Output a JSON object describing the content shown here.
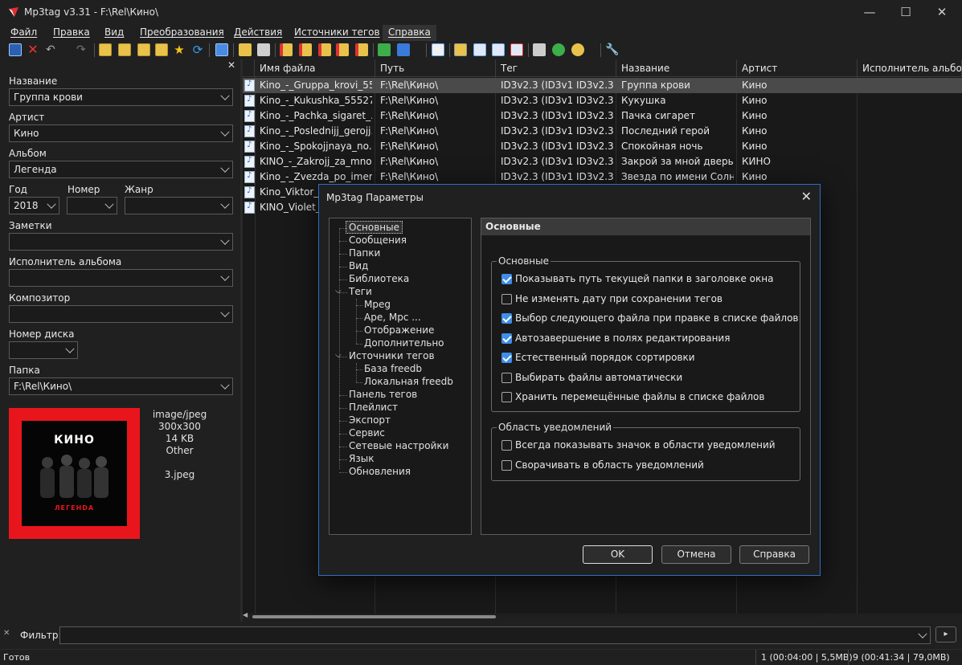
{
  "window": {
    "title": "Mp3tag v3.31  -  F:\\Rel\\Кино\\",
    "minimize": "—",
    "maximize": "☐",
    "close": "✕"
  },
  "menu": [
    "Файл",
    "Правка",
    "Вид",
    "Преобразования",
    "Действия",
    "Источники тегов",
    "Справка"
  ],
  "left_panel": {
    "close": "✕",
    "fields": {
      "title_label": "Название",
      "title_value": "Группа крови",
      "artist_label": "Артист",
      "artist_value": "Кино",
      "album_label": "Альбом",
      "album_value": "Легенда",
      "year_label": "Год",
      "year_value": "2018",
      "track_label": "Номер",
      "track_value": "",
      "genre_label": "Жанр",
      "genre_value": "",
      "comment_label": "Заметки",
      "comment_value": "",
      "albumartist_label": "Исполнитель альбома",
      "albumartist_value": "",
      "composer_label": "Композитор",
      "composer_value": "",
      "discnumber_label": "Номер диска",
      "discnumber_value": "",
      "folder_label": "Папка",
      "folder_value": "F:\\Rel\\Кино\\"
    },
    "cover": {
      "band": "КИНО",
      "album": "ЛЕГЕНDА"
    },
    "image_info": {
      "mime": "image/jpeg",
      "dims": "300x300",
      "size": "14 KB",
      "type": "Other",
      "file": "3.jpeg"
    }
  },
  "file_list": {
    "headers": [
      "Имя файла",
      "Путь",
      "Тег",
      "Название",
      "Артист",
      "Исполнитель альбома"
    ],
    "rows": [
      {
        "file": "Kino_-_Gruppa_krovi_55...",
        "path": "F:\\Rel\\Кино\\",
        "tag": "ID3v2.3 (ID3v1 ID3v2.3)",
        "title": "Группа крови",
        "artist": "Кино"
      },
      {
        "file": "Kino_-_Kukushka_55527...",
        "path": "F:\\Rel\\Кино\\",
        "tag": "ID3v2.3 (ID3v1 ID3v2.3)",
        "title": "Кукушка",
        "artist": "Кино"
      },
      {
        "file": "Kino_-_Pachka_sigaret_...",
        "path": "F:\\Rel\\Кино\\",
        "tag": "ID3v2.3 (ID3v1 ID3v2.3)",
        "title": "Пачка сигарет",
        "artist": "Кино"
      },
      {
        "file": "Kino_-_Poslednijj_gerojj...",
        "path": "F:\\Rel\\Кино\\",
        "tag": "ID3v2.3 (ID3v1 ID3v2.3)",
        "title": "Последний герой",
        "artist": "Кино"
      },
      {
        "file": "Kino_-_Spokojjnaya_no...",
        "path": "F:\\Rel\\Кино\\",
        "tag": "ID3v2.3 (ID3v1 ID3v2.3)",
        "title": "Спокойная ночь",
        "artist": "Кино"
      },
      {
        "file": "KINO_-_Zakrojj_za_mno...",
        "path": "F:\\Rel\\Кино\\",
        "tag": "ID3v2.3 (ID3v1 ID3v2.3)",
        "title": "Закрой за мной дверь",
        "artist": "КИНО"
      },
      {
        "file": "Kino_-_Zvezda_po_imen...",
        "path": "F:\\Rel\\Кино\\",
        "tag": "ID3v2.3 (ID3v1 ID3v2.3)",
        "title": "Звезда по имени Солн...",
        "artist": "Кино"
      },
      {
        "file": "Kino_Viktor_C",
        "path": "",
        "tag": "",
        "title": "",
        "artist": ""
      },
      {
        "file": "KINO_Violet_S",
        "path": "",
        "tag": "",
        "title": "",
        "artist": ""
      }
    ]
  },
  "filter": {
    "label": "Фильтр:",
    "value": "",
    "go": "▸"
  },
  "status": {
    "left": "Готов",
    "selected": "1 (00:04:00 | 5,5MB)",
    "total": "9 (00:41:34 | 79,0MB)"
  },
  "dialog": {
    "title": "Mp3tag Параметры",
    "close": "✕",
    "tree": [
      "Основные",
      "Сообщения",
      "Папки",
      "Вид",
      "Библиотека",
      "Теги",
      "Mpeg",
      "Ape, Mpc ...",
      "Отображение",
      "Дополнительно",
      "Источники тегов",
      "База freedb",
      "Локальная freedb",
      "Панель тегов",
      "Плейлист",
      "Экспорт",
      "Сервис",
      "Сетевые настройки",
      "Язык",
      "Обновления"
    ],
    "section_title": "Основные",
    "group1": {
      "title": "Основные",
      "options": [
        {
          "label": "Показывать путь текущей папки в заголовке окна",
          "checked": true
        },
        {
          "label": "Не изменять дату при сохранении тегов",
          "checked": false
        },
        {
          "label": "Выбор следующего файла при правке в списке файлов",
          "checked": true
        },
        {
          "label": "Автозавершение в полях редактирования",
          "checked": true
        },
        {
          "label": "Естественный порядок сортировки",
          "checked": true
        },
        {
          "label": "Выбирать файлы автоматически",
          "checked": false
        },
        {
          "label": "Хранить перемещённые файлы в списке файлов",
          "checked": false
        }
      ]
    },
    "group2": {
      "title": "Область уведомлений",
      "options": [
        {
          "label": "Всегда показывать значок в области уведомлений",
          "checked": false
        },
        {
          "label": "Сворачивать в область уведомлений",
          "checked": false
        }
      ]
    },
    "buttons": {
      "ok": "OK",
      "cancel": "Отмена",
      "help": "Справка"
    }
  },
  "colors": {
    "accent": "#2a6fc7",
    "checkbox_on": "#3f8ee8",
    "cover_red": "#e8161c",
    "selection": "#4a4a4a"
  }
}
